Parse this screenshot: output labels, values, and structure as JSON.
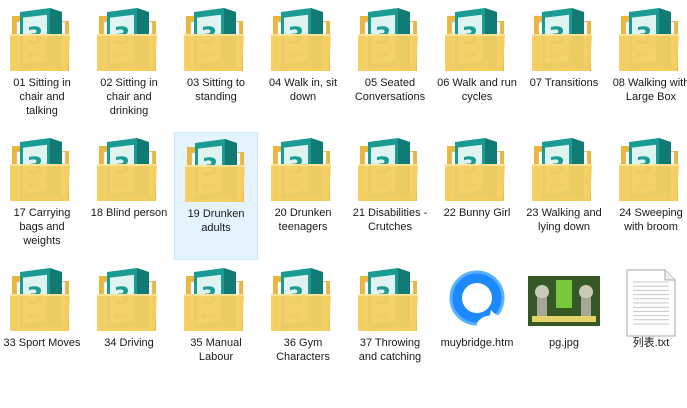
{
  "items": [
    {
      "label": "01 Sitting in chair and talking",
      "icon": "3d-folder-icon"
    },
    {
      "label": "02 Sitting in chair and drinking",
      "icon": "3d-folder-icon"
    },
    {
      "label": "03 Sitting to standing",
      "icon": "3d-folder-icon"
    },
    {
      "label": "04 Walk in, sit down",
      "icon": "3d-folder-icon"
    },
    {
      "label": "05 Seated Conversations",
      "icon": "3d-folder-icon"
    },
    {
      "label": "06 Walk and run cycles",
      "icon": "3d-folder-icon"
    },
    {
      "label": "07 Transitions",
      "icon": "3d-folder-icon"
    },
    {
      "label": "08 Walking with Large Box",
      "icon": "3d-folder-icon"
    },
    {
      "label": "17 Carrying bags and weights",
      "icon": "3d-folder-icon"
    },
    {
      "label": "18 Blind person",
      "icon": "3d-folder-icon"
    },
    {
      "label": "19 Drunken adults",
      "icon": "3d-folder-icon",
      "selected": true
    },
    {
      "label": "20 Drunken teenagers",
      "icon": "3d-folder-icon"
    },
    {
      "label": "21 Disabilities - Crutches",
      "icon": "3d-folder-icon"
    },
    {
      "label": "22 Bunny Girl",
      "icon": "3d-folder-icon"
    },
    {
      "label": "23 Walking and lying down",
      "icon": "3d-folder-icon"
    },
    {
      "label": "24 Sweeping with broom",
      "icon": "3d-folder-icon"
    },
    {
      "label": "33 Sport Moves",
      "icon": "3d-folder-icon"
    },
    {
      "label": "34 Driving",
      "icon": "3d-folder-icon"
    },
    {
      "label": "35 Manual Labour",
      "icon": "3d-folder-icon"
    },
    {
      "label": "36 Gym Characters",
      "icon": "3d-folder-icon"
    },
    {
      "label": "37 Throwing and catching",
      "icon": "3d-folder-icon"
    },
    {
      "label": "muybridge.htm",
      "icon": "browser-logo-icon"
    },
    {
      "label": "pg.jpg",
      "icon": "image-thumbnail-icon"
    },
    {
      "label": "列表.txt",
      "icon": "text-file-icon"
    }
  ],
  "badge_text": "3",
  "badge_subtext": "BIP",
  "colors": {
    "folder_front": "#f5cf63",
    "folder_back": "#e9b740",
    "badge_teal": "#1a9c94",
    "badge_light": "#dff3f1",
    "selection_bg": "#e5f3ff",
    "browser_blue": "#1e88ff"
  }
}
